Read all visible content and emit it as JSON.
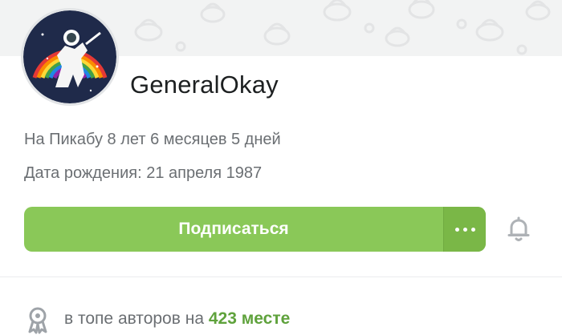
{
  "profile": {
    "username": "GeneralOkay",
    "avatar_icon": "astronaut-unicorn-rainbow-avatar",
    "on_site": "На Пикабу 8 лет 6 месяцев 5 дней",
    "birthday": "Дата рождения: 21 апреля 1987"
  },
  "actions": {
    "subscribe_label": "Подписаться",
    "more_icon": "more-dots-icon",
    "bell_icon": "bell-icon"
  },
  "rating": {
    "icon": "award-ribbon-icon",
    "prefix": "в топе авторов на",
    "place": "423 месте"
  },
  "colors": {
    "accent_green": "#8ac858",
    "accent_green_dark": "#7ab747",
    "rank_green": "#5fa23c",
    "cover_bg": "#f2f3f3",
    "text_primary": "#1d2021",
    "text_secondary": "#6b6f73"
  }
}
